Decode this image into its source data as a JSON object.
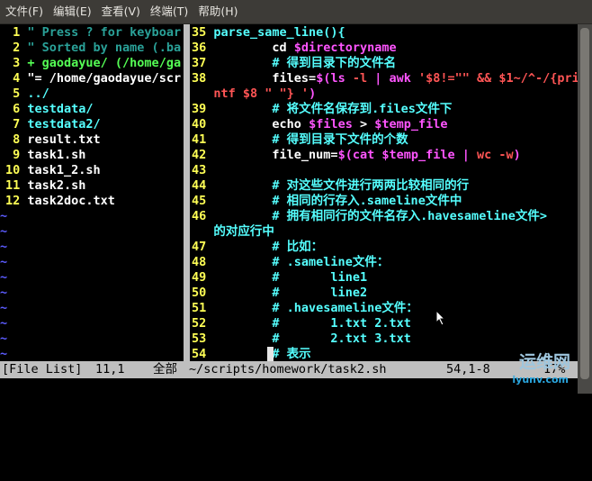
{
  "menu": [
    "文件(F)",
    "编辑(E)",
    "查看(V)",
    "终端(T)",
    "帮助(H)"
  ],
  "left_pane": {
    "lines": [
      {
        "n": " 1",
        "segs": [
          {
            "t": "\" Press ? for keyboar",
            "c": "#2aa198"
          }
        ]
      },
      {
        "n": " 2",
        "segs": [
          {
            "t": "\" Sorted by name (.ba",
            "c": "#2aa198"
          }
        ]
      },
      {
        "n": " 3",
        "segs": [
          {
            "t": "+ gaodayue/ (/home/ga",
            "c": "#55ff55"
          }
        ]
      },
      {
        "n": " 4",
        "segs": [
          {
            "t": "\"= /home/gaodayue/scr",
            "c": "#ffffff"
          }
        ]
      },
      {
        "n": " 5",
        "segs": [
          {
            "t": "../",
            "c": "#55ffff"
          }
        ]
      },
      {
        "n": " 6",
        "segs": [
          {
            "t": "testdata/",
            "c": "#55ffff"
          }
        ]
      },
      {
        "n": " 7",
        "segs": [
          {
            "t": "testdata2/",
            "c": "#55ffff"
          }
        ]
      },
      {
        "n": " 8",
        "segs": [
          {
            "t": "result.txt",
            "c": "#ffffff"
          }
        ]
      },
      {
        "n": " 9",
        "segs": [
          {
            "t": "task1.sh",
            "c": "#ffffff"
          }
        ]
      },
      {
        "n": "10",
        "segs": [
          {
            "t": "task1_2.sh",
            "c": "#ffffff"
          }
        ]
      },
      {
        "n": "11",
        "segs": [
          {
            "t": "task2.sh",
            "c": "#ffffff"
          }
        ]
      },
      {
        "n": "12",
        "segs": [
          {
            "t": "task2doc.txt",
            "c": "#ffffff"
          }
        ]
      }
    ],
    "tilde": "~"
  },
  "right_pane": {
    "lines": [
      {
        "n": "35",
        "segs": [
          {
            "t": "parse_same_line(){",
            "c": "#55ffff"
          }
        ]
      },
      {
        "n": "36",
        "segs": [
          {
            "t": "        cd ",
            "c": "#ffffff"
          },
          {
            "t": "$directoryname",
            "c": "#ff55ff"
          }
        ]
      },
      {
        "n": "37",
        "segs": [
          {
            "t": "        # 得到目录下的文件名",
            "c": "#55ffff"
          }
        ]
      },
      {
        "n": "38",
        "segs": [
          {
            "t": "        files=",
            "c": "#ffffff"
          },
          {
            "t": "$(ls ",
            "c": "#ff55ff"
          },
          {
            "t": "-l",
            "c": "#ff5555"
          },
          {
            "t": " | awk ",
            "c": "#ff55ff"
          },
          {
            "t": "'$8!=\"\" && $1~/^-/{pri",
            "c": "#ff5555"
          }
        ]
      },
      {
        "n": "",
        "segs": [
          {
            "t": "ntf $8 \" \"} '",
            "c": "#ff5555"
          },
          {
            "t": ")",
            "c": "#ff55ff"
          }
        ]
      },
      {
        "n": "39",
        "segs": [
          {
            "t": "        # 将文件名保存到.files文件下",
            "c": "#55ffff"
          }
        ]
      },
      {
        "n": "40",
        "segs": [
          {
            "t": "        echo ",
            "c": "#ffffff"
          },
          {
            "t": "$files",
            "c": "#ff55ff"
          },
          {
            "t": " > ",
            "c": "#ffffff"
          },
          {
            "t": "$temp_file",
            "c": "#ff55ff"
          }
        ]
      },
      {
        "n": "41",
        "segs": [
          {
            "t": "        # 得到目录下文件的个数",
            "c": "#55ffff"
          }
        ]
      },
      {
        "n": "42",
        "segs": [
          {
            "t": "        file_num=",
            "c": "#ffffff"
          },
          {
            "t": "$(cat ",
            "c": "#ff55ff"
          },
          {
            "t": "$temp_file",
            "c": "#ff55ff"
          },
          {
            "t": " | ",
            "c": "#ff55ff"
          },
          {
            "t": "wc -w",
            "c": "#ff5555"
          },
          {
            "t": ")",
            "c": "#ff55ff"
          }
        ]
      },
      {
        "n": "43",
        "segs": [
          {
            "t": "",
            "c": "#ffffff"
          }
        ]
      },
      {
        "n": "44",
        "segs": [
          {
            "t": "        # 对这些文件进行两两比较相同的行",
            "c": "#55ffff"
          }
        ]
      },
      {
        "n": "45",
        "segs": [
          {
            "t": "        # 相同的行存入.sameline文件中",
            "c": "#55ffff"
          }
        ]
      },
      {
        "n": "46",
        "segs": [
          {
            "t": "        # 拥有相同行的文件名存入.havesameline文件>",
            "c": "#55ffff"
          }
        ]
      },
      {
        "n": "",
        "segs": [
          {
            "t": "的对应行中",
            "c": "#55ffff"
          }
        ]
      },
      {
        "n": "47",
        "segs": [
          {
            "t": "        # 比如：",
            "c": "#55ffff"
          }
        ]
      },
      {
        "n": "48",
        "segs": [
          {
            "t": "        # .sameline文件：",
            "c": "#55ffff"
          }
        ]
      },
      {
        "n": "49",
        "segs": [
          {
            "t": "        #       line1",
            "c": "#55ffff"
          }
        ]
      },
      {
        "n": "50",
        "segs": [
          {
            "t": "        #       line2",
            "c": "#55ffff"
          }
        ]
      },
      {
        "n": "51",
        "segs": [
          {
            "t": "        # .havesameline文件：",
            "c": "#55ffff"
          }
        ]
      },
      {
        "n": "52",
        "segs": [
          {
            "t": "        #       1.txt 2.txt",
            "c": "#55ffff"
          }
        ]
      },
      {
        "n": "53",
        "segs": [
          {
            "t": "        #       2.txt 3.txt",
            "c": "#55ffff"
          }
        ]
      },
      {
        "n": "54",
        "segs": [
          {
            "t": "        # 表示",
            "c": "#55ffff"
          }
        ]
      }
    ]
  },
  "status": {
    "left_label": "[File List]",
    "left_pos": "11,1",
    "left_pct": "全部",
    "right_file": "~/scripts/homework/task2.sh",
    "right_pos": "54,1-8",
    "right_pct": "17%"
  },
  "watermark": {
    "line1": "运维网",
    "line2": "iyunv.com"
  }
}
